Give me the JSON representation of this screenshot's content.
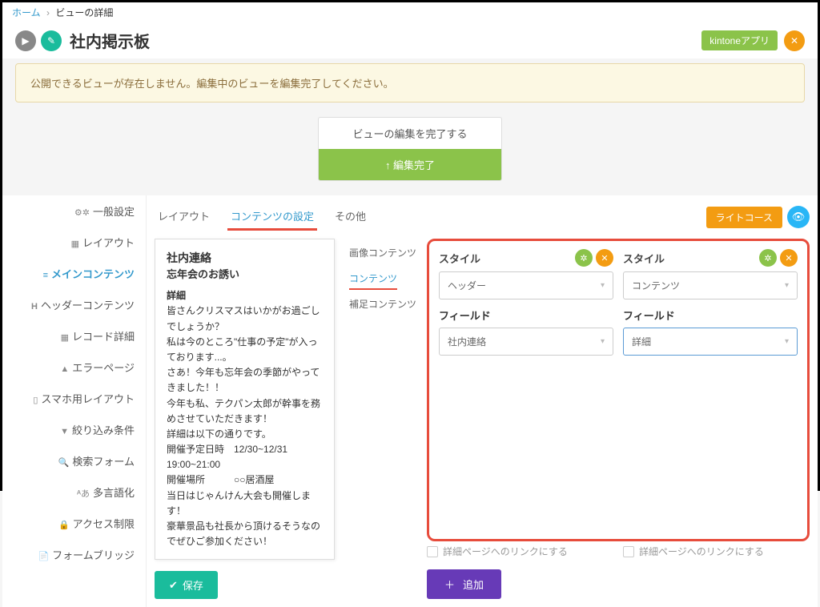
{
  "breadcrumb": {
    "home": "ホーム",
    "current": "ビューの詳細"
  },
  "header": {
    "title": "社内掲示板",
    "kintone_badge": "kintoneアプリ"
  },
  "warning": "公開できるビューが存在しません。編集中のビューを編集完了してください。",
  "edit_complete": {
    "label": "ビューの編集を完了する",
    "button": "↑  編集完了"
  },
  "sidebar": {
    "items": [
      {
        "icon": "⚙",
        "label": "一般設定"
      },
      {
        "icon": "▦",
        "label": "レイアウト"
      },
      {
        "icon": "≡",
        "label": "メインコンテンツ",
        "active": true
      },
      {
        "icon": "H",
        "label": "ヘッダーコンテンツ"
      },
      {
        "icon": "▦",
        "label": "レコード詳細"
      },
      {
        "icon": "▲",
        "label": "エラーページ"
      },
      {
        "icon": "▯",
        "label": "スマホ用レイアウト"
      },
      {
        "icon": "▼",
        "label": "絞り込み条件"
      },
      {
        "icon": "🔍",
        "label": "検索フォーム"
      },
      {
        "icon": "ᴬあ",
        "label": "多言語化"
      },
      {
        "icon": "🔒",
        "label": "アクセス制限"
      },
      {
        "icon": "📄",
        "label": "フォームブリッジ"
      }
    ]
  },
  "tabs": [
    {
      "label": "レイアウト"
    },
    {
      "label": "コンテンツの設定",
      "active": true
    },
    {
      "label": "その他"
    }
  ],
  "course_badge": "ライトコース",
  "preview": {
    "title": "社内連絡",
    "subtitle": "忘年会のお誘い",
    "section": "詳細",
    "body": "皆さんクリスマスはいかがお過ごしでしょうか？\n私は今のところ\"仕事の予定\"が入っております...。\nさあ！今年も忘年会の季節がやってきました！！\n今年も私、テクパン太郎が幹事を務めさせていただきます！\n詳細は以下の通りです。\n開催予定日時　12/30~12/31\n19:00~21:00\n開催場所　　　○○居酒屋\n当日はじゃんけん大会も開催します！\n豪華景品も社長から頂けるそうなのでぜひご参加ください！"
  },
  "save_button": "保存",
  "config_labels": {
    "image": "画像コンテンツ",
    "content": "コンテンツ",
    "supplement": "補足コンテンツ"
  },
  "columns": [
    {
      "style_label": "スタイル",
      "style_value": "ヘッダー",
      "field_label": "フィールド",
      "field_value": "社内連絡",
      "link_label": "詳細ページへのリンクにする"
    },
    {
      "style_label": "スタイル",
      "style_value": "コンテンツ",
      "field_label": "フィールド",
      "field_value": "詳細",
      "link_label": "詳細ページへのリンクにする"
    }
  ],
  "add_button": "追加"
}
